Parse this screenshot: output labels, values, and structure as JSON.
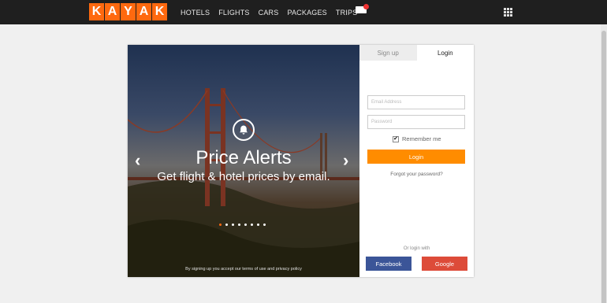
{
  "brand": {
    "letters": [
      "K",
      "A",
      "Y",
      "A",
      "K"
    ],
    "color": "#ff690f"
  },
  "nav": {
    "items": [
      "HOTELS",
      "FLIGHTS",
      "CARS",
      "PACKAGES",
      "TRIPS"
    ],
    "trips_badge_icon": "envelope-icon",
    "menu_icon": "grid-icon"
  },
  "hero": {
    "title": "Price Alerts",
    "subtitle": "Get flight & hotel prices by email.",
    "icon": "bell-icon",
    "prev_icon": "‹",
    "next_icon": "›",
    "slide_count": 8,
    "active_slide": 1,
    "terms": "By signing up you accept our terms of use and privacy policy"
  },
  "auth": {
    "tabs": [
      "Sign up",
      "Login"
    ],
    "active_tab": "Login",
    "email_placeholder": "Email Address",
    "password_placeholder": "Password",
    "remember_label": "Remember me",
    "remember_checked": "✔",
    "login_button": "Login",
    "forgot_link": "Forgot your password?",
    "or_login_with": "Or login with",
    "facebook_button": "Facebook",
    "google_button": "Google",
    "colors": {
      "login": "#ff8c00",
      "facebook": "#3b5598",
      "google": "#dd4b39"
    }
  }
}
